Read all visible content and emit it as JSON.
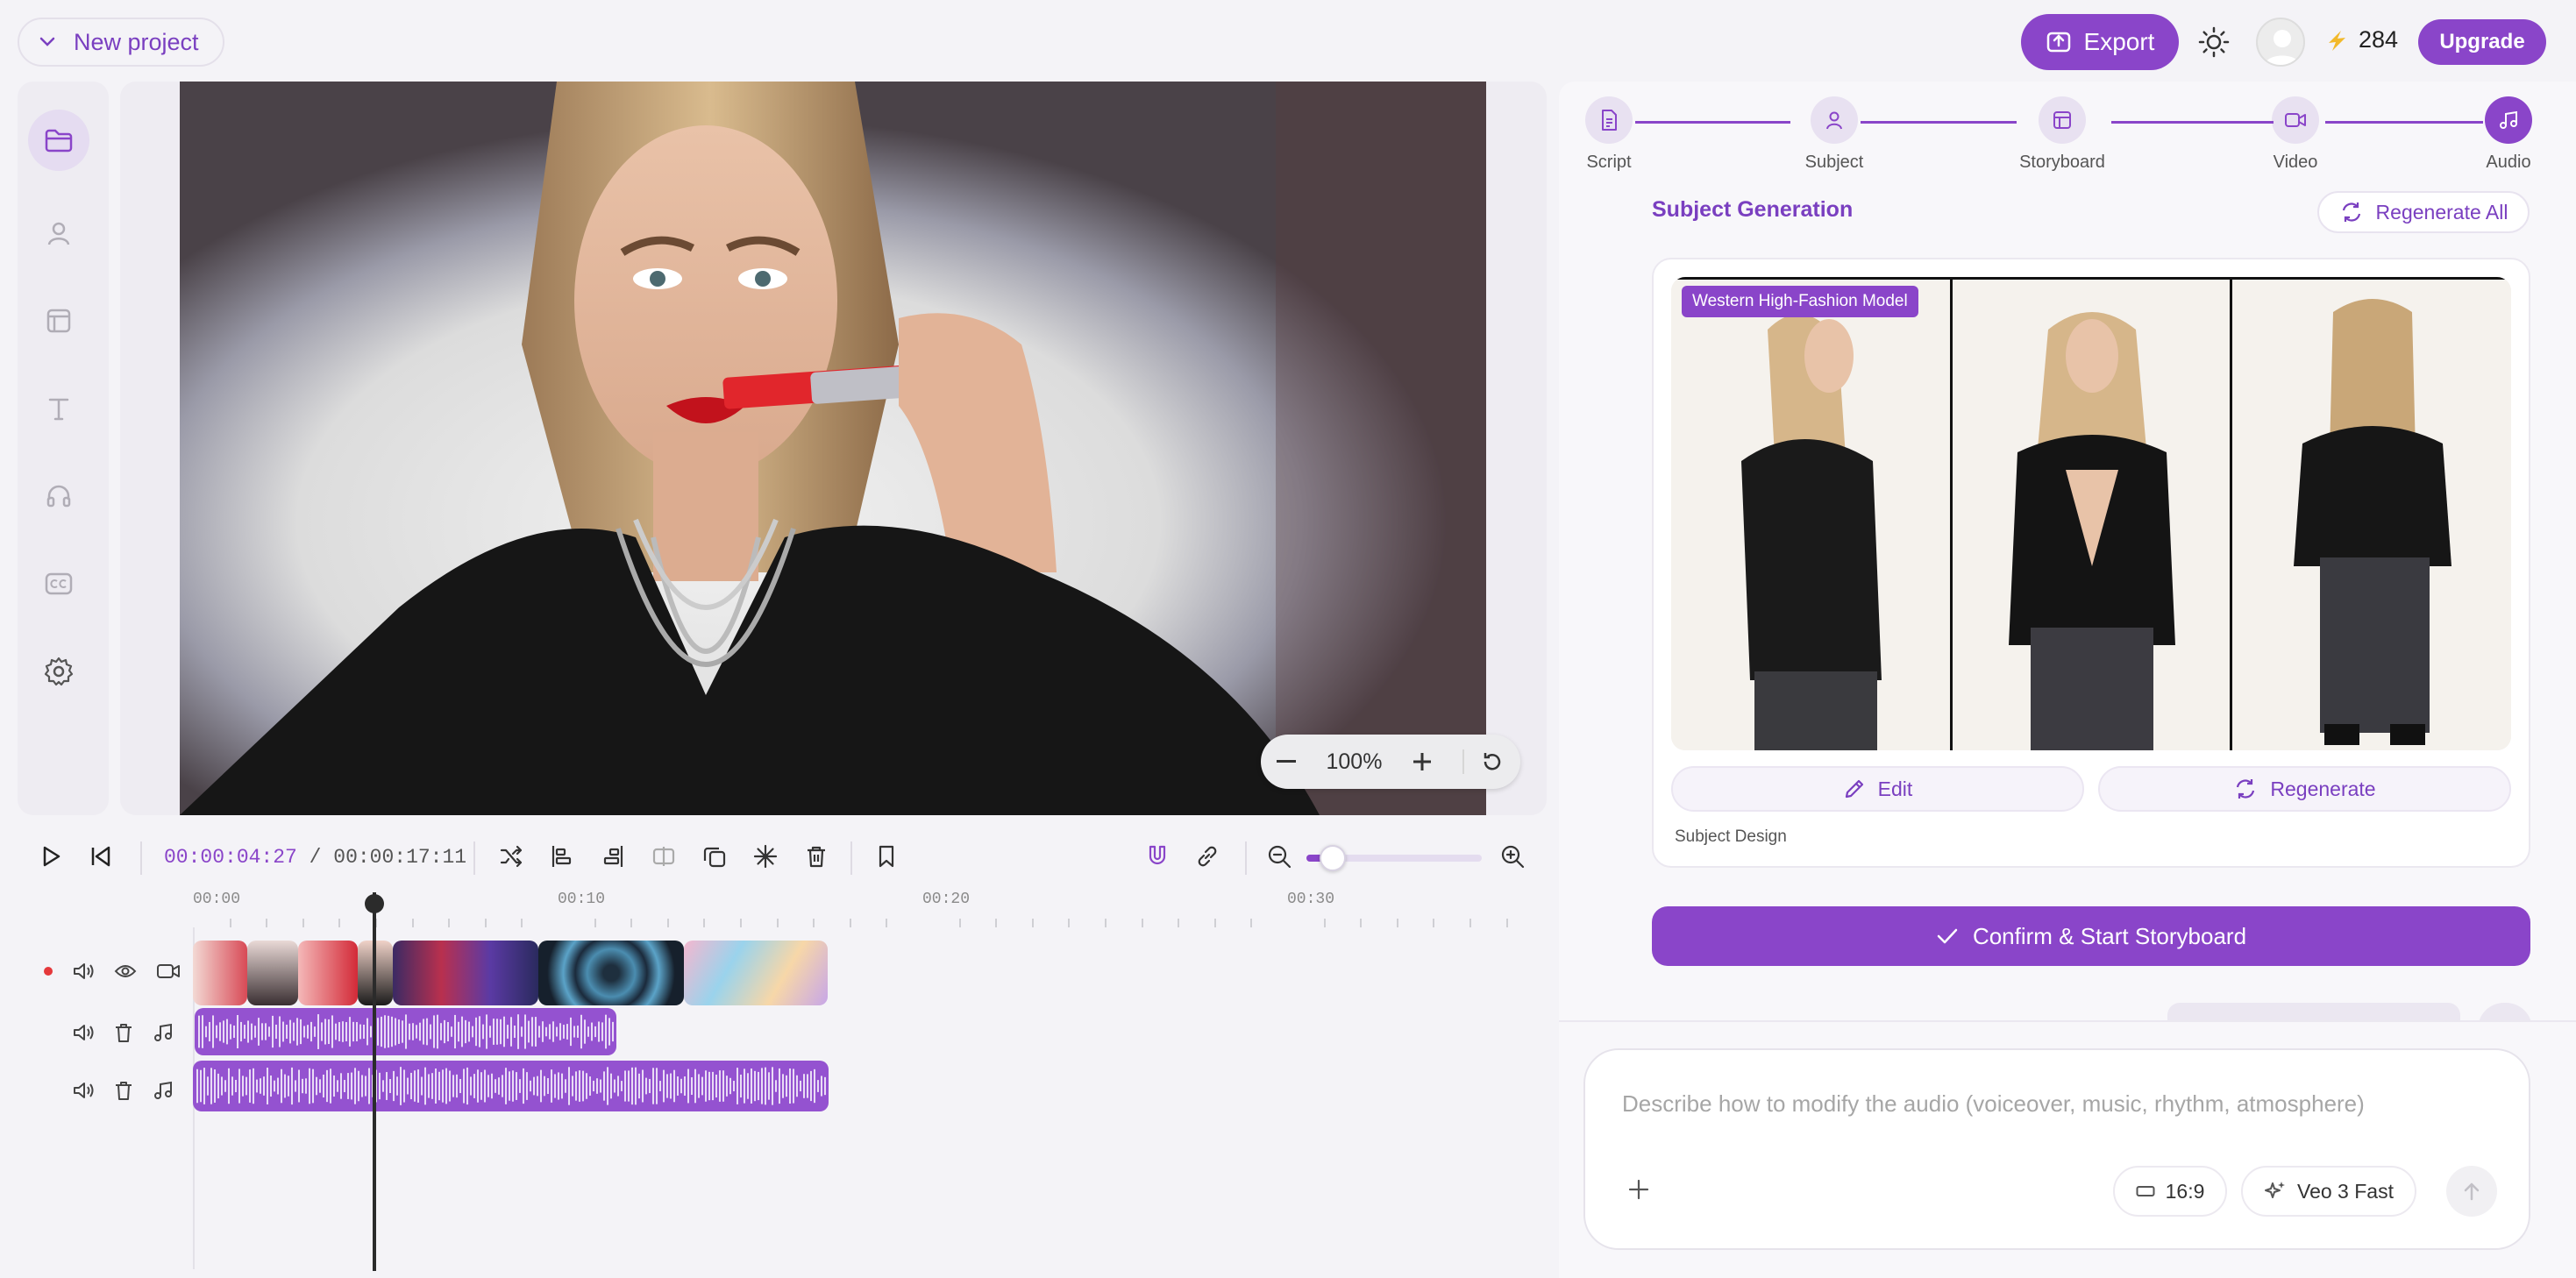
{
  "header": {
    "project_label": "New project",
    "export_label": "Export",
    "credits": "284",
    "upgrade_label": "Upgrade"
  },
  "sidebar": {
    "items": [
      {
        "icon": "folder-icon",
        "active": true
      },
      {
        "icon": "person-icon",
        "active": false
      },
      {
        "icon": "layout-icon",
        "active": false
      },
      {
        "icon": "text-icon",
        "active": false
      },
      {
        "icon": "headphones-icon",
        "active": false
      },
      {
        "icon": "captions-icon",
        "active": false
      },
      {
        "icon": "gear-icon",
        "active": false
      }
    ]
  },
  "preview": {
    "zoom_level": "100%"
  },
  "timeline": {
    "current_time": "00:00:04:27",
    "separator": "/",
    "total_time": "00:00:17:11",
    "ruler_labels": [
      "00:00",
      "00:10",
      "00:20",
      "00:30"
    ],
    "zoom_slider_fraction": 0.15
  },
  "stepper": {
    "steps": [
      {
        "label": "Script",
        "icon": "document-icon",
        "active": false
      },
      {
        "label": "Subject",
        "icon": "person-icon",
        "active": false
      },
      {
        "label": "Storyboard",
        "icon": "layout-icon",
        "active": false
      },
      {
        "label": "Video",
        "icon": "video-icon",
        "active": false
      },
      {
        "label": "Audio",
        "icon": "music-icon",
        "active": true
      }
    ]
  },
  "subject": {
    "title": "Subject Generation",
    "regenerate_all_label": "Regenerate All",
    "model_tag": "Western High-Fashion Model",
    "edit_label": "Edit",
    "regenerate_label": "Regenerate",
    "caption": "Subject Design",
    "confirm_label": "Confirm & Start Storyboard"
  },
  "prompt": {
    "placeholder": "Describe how to modify the audio (voiceover, music, rhythm, atmosphere)",
    "aspect_ratio": "16:9",
    "model": "Veo 3 Fast"
  },
  "colors": {
    "accent": "#8a45c9",
    "accent_light": "#e8e1f1",
    "background": "#f4f3f7"
  }
}
